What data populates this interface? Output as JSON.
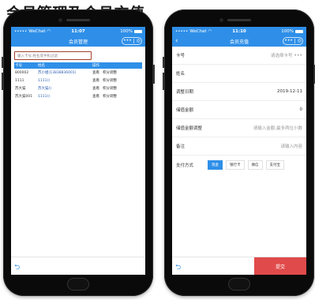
{
  "banner": {
    "text": "会员管理及会员充值"
  },
  "status_bar": {
    "carrier": "WeChat",
    "battery": "100%"
  },
  "left_screen": {
    "time": "11:07",
    "title": "会员管理",
    "search": {
      "placeholder": "输入卡号,姓名或手机过滤"
    },
    "table": {
      "headers": [
        "卡号",
        "姓名",
        "操作"
      ],
      "rows": [
        {
          "card": "800002",
          "name": "苏小姐(13838836001)",
          "view": "查看",
          "adjust": "积分调整"
        },
        {
          "card": "1111",
          "name": "1111()",
          "view": "查看",
          "adjust": "积分调整"
        },
        {
          "card": "苏大猫",
          "name": "苏大猫()",
          "view": "查看",
          "adjust": "积分调整"
        },
        {
          "card": "苏大猫001",
          "name": "1111()",
          "view": "查看",
          "adjust": "积分调整"
        }
      ]
    }
  },
  "right_screen": {
    "time": "11:10",
    "title": "会员充值",
    "fields": [
      {
        "label": "卡号",
        "value": "请选择卡号",
        "type": "select"
      },
      {
        "label": "姓名",
        "value": "",
        "type": "text"
      },
      {
        "label": "调整日期",
        "value": "2019-12-11",
        "type": "date"
      },
      {
        "label": "储值金额",
        "value": "0",
        "type": "text"
      },
      {
        "label": "储值金额调整",
        "value": "请输入金额,最多两位小数",
        "type": "input"
      },
      {
        "label": "备注",
        "value": "请输入内容",
        "type": "input"
      }
    ],
    "payment": {
      "label": "支付方式",
      "options": [
        "现金",
        "银行卡",
        "微信",
        "支付宝"
      ],
      "selected": "现金"
    },
    "submit_label": "提交"
  },
  "colors": {
    "primary": "#2f8fe8",
    "submit": "#e14a4a",
    "search_border": "#a0402c",
    "link": "#2a5db0"
  },
  "icons": {
    "back": "chevron-left-icon",
    "undo": "undo-icon",
    "more": "more-dots-icon",
    "close": "target-icon"
  }
}
